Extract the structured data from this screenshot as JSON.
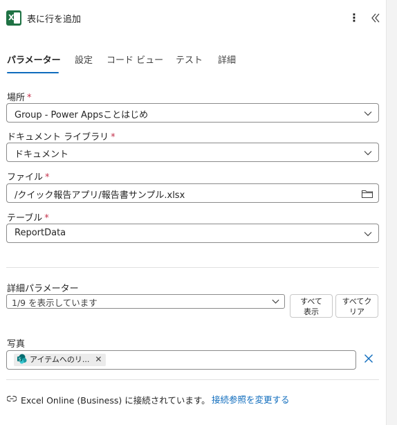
{
  "header": {
    "title": "表に行を追加",
    "more_icon": "more-vertical-icon",
    "collapse_icon": "double-chevron-left-icon",
    "app_icon": "excel-icon"
  },
  "tabs": [
    {
      "label": "パラメーター",
      "active": true
    },
    {
      "label": "設定",
      "active": false
    },
    {
      "label": "コード ビュー",
      "active": false
    },
    {
      "label": "テスト",
      "active": false
    },
    {
      "label": "詳細",
      "active": false
    }
  ],
  "fields": {
    "location": {
      "label": "場所",
      "required": "*",
      "value": "Group - Power Appsことはじめ"
    },
    "library": {
      "label": "ドキュメント ライブラリ",
      "required": "*",
      "value": "ドキュメント"
    },
    "file": {
      "label": "ファイル",
      "required": "*",
      "value": "/クイック報告アプリ/報告書サンプル.xlsx"
    },
    "table": {
      "label": "テーブル",
      "required": "*",
      "value": "ReportData"
    }
  },
  "advanced": {
    "label": "詳細パラメーター",
    "select_value": "1/9 を表示しています",
    "show_all_line1": "すべて",
    "show_all_line2": "表示",
    "clear_all_line1": "すべてク",
    "clear_all_line2": "リア"
  },
  "photo": {
    "label": "写真",
    "chip_text": "アイテムへのリ...",
    "chip_close": "✕"
  },
  "connection": {
    "text": "Excel Online (Business) に接続されています。",
    "link": "接続参照を変更する"
  },
  "colors": {
    "accent": "#0f6cbd",
    "required": "#c4314b",
    "excel_green": "#1f7244"
  }
}
